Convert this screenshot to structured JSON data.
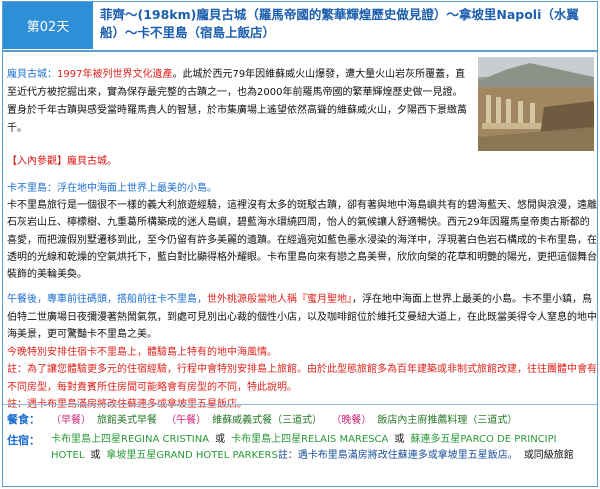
{
  "header": {
    "day": "第02天",
    "title": "菲齊～(198km)龐貝古城（羅馬帝國的繁華輝煌歷史做見證）～拿坡里Napoli（水翼船）～卡不里島（宿島上飯店）"
  },
  "pompeii": {
    "name": "龐貝古城：",
    "heritage": "1997年被列世界文化遺產",
    "body": "。此城於西元79年因維蘇威火山爆發，遭大量火山岩灰所覆蓋，直至近代方被挖掘出來，實為保存最完整的古蹟之一，也為2000年前羅馬帝國的繁華輝煌歷史做一見證。置身於千年古蹟與感受當時羅馬貴人的智慧，於市集廣場上遙望依然高聳的維蘇威火山，夕陽西下景緻萬千。"
  },
  "entry": {
    "tag": "【入內參觀】",
    "text": "龐貝古城。"
  },
  "capri": {
    "heading": "卡不里島：浮在地中海面上世界上最美的小島。",
    "body": "卡不里島旅行是一個很不一樣的義大利旅遊經驗，這裡沒有太多的斑駁古蹟，卻有著與地中海島嶼共有的碧海藍天、悠閒與浪漫，遠離石灰岩山丘、檸檬樹、九重葛所構築成的迷人島嶼，碧藍海水環繞四周，怡人的氣候讓人舒適暢快。西元29年因羅馬皇帝奧古斯都的喜愛，而把渡假別墅遷移到此，至今仍留有許多美麗的遺蹟。在經過宛如藍色墨水浸染的海洋中，浮現著白色岩石構成的卡布里島，在透明的光線和乾燥的空氣烘托下，藍白對比顯得格外耀眼。卡布里島向來有戀之島美譽，欣欣向榮的花草和明艷的陽光，更把這個舞台裝飾的美輪美奐。"
  },
  "afternoon": {
    "lead": "午餐後，專車前往碼頭，搭船前往卡不里島，",
    "highlight": "世外桃源般當地人稱『蜜月聖地』",
    "rest": "，浮在地中海面上世界上最美的小島。卡不里小鎮，鳥伯特二世廣場日夜彌漫著熱鬧氣氛，到處可見別出心裁的個性小店，以及咖啡館位於維托艾曼紐大道上，在此既當美得令人窒息的地中海美景，更可驚豔卡不里島之美。",
    "special": "今晚特別安排住宿卡不里島上，體驗島上特有的地中海風情。",
    "note1": "註：為了讓您體驗更多元的住宿經驗，行程中會特別安排島上旅館。由於此型態旅館多為百年建築或非制式旅館改建，往往團體中會有不同房型，每對貴賓所住房間可能略會有房型的不同，特此說明。",
    "note2": "註：遇卡布里島滿房將改住蘇連多或拿坡里五星飯店。"
  },
  "meals": {
    "label": "餐食：",
    "items": [
      {
        "tag": "（早餐）",
        "name": "旅館美式早餐"
      },
      {
        "tag": "（午餐）",
        "name": "維蘇威義式餐（三道式）"
      },
      {
        "tag": "（晚餐）",
        "name": "飯店內主廚推薦料理（三道式）"
      }
    ]
  },
  "hotels": {
    "label": "住宿：",
    "h1": "卡布里島上四星REGINA CRISTINA",
    "or1": "或",
    "h2": "卡布里島上四星RELAIS MARESCA",
    "or2": "或",
    "h3": "蘇連多五星PARCO DE PRINCIPI HOTEL",
    "or3": "或",
    "h4": "拿坡里五星GRAND HOTEL PARKERS",
    "note": "註：遇卡布里島滿房將改住蘇連多或拿坡里五星飯店。",
    "or4": "或同級旅館"
  },
  "colors": {
    "accent": "#2e8fd6",
    "title": "#1c5fae",
    "red": "#e0231e",
    "blue": "#1d6fd0",
    "green": "#2a9a3a",
    "pink": "#d4237a"
  }
}
